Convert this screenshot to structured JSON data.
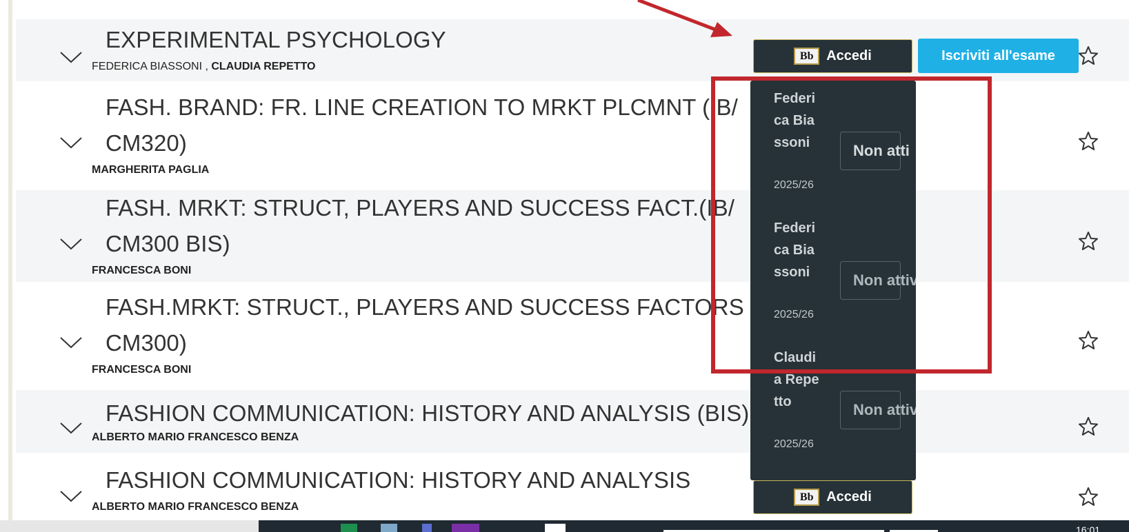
{
  "courses": [
    {
      "title_line1": "EXPERIMENTAL PSYCHOLOGY",
      "title_line2": "",
      "teacher_regular": "FEDERICA BIASSONI , ",
      "teacher_bold": "CLAUDIA REPETTO"
    },
    {
      "title_line1": "FASH. BRAND: FR. LINE CREATION TO MRKT PLCMNT (IB/",
      "title_line2": "CM320)",
      "teacher_regular": "",
      "teacher_bold": "MARGHERITA PAGLIA"
    },
    {
      "title_line1": "FASH. MRKT: STRUCT, PLAYERS AND SUCCESS FACT.(IB/",
      "title_line2": "CM300 BIS)",
      "teacher_regular": "",
      "teacher_bold": "FRANCESCA BONI"
    },
    {
      "title_line1": "FASH.MRKT: STRUCT., PLAYERS AND SUCCESS FACTORS (IB/",
      "title_line2": "CM300)",
      "teacher_regular": "",
      "teacher_bold": "FRANCESCA BONI"
    },
    {
      "title_line1": "FASHION COMMUNICATION: HISTORY AND ANALYSIS (BIS)",
      "title_line2": "",
      "teacher_regular": "",
      "teacher_bold": "ALBERTO MARIO FRANCESCO BENZA"
    },
    {
      "title_line1": "FASHION COMMUNICATION: HISTORY AND ANALYSIS",
      "title_line2": "",
      "teacher_regular": "",
      "teacher_bold": "ALBERTO MARIO FRANCESCO BENZA"
    }
  ],
  "buttons": {
    "accedi_label": "Accedi",
    "bb_logo_text": "Bb",
    "iscriviti_label": "Iscriviti all'esame"
  },
  "dropdown": {
    "items": [
      {
        "name": "Federica Biassoni",
        "date": "2025/26",
        "status": "Non atti"
      },
      {
        "name": "Federica Biassoni",
        "date": "2025/26",
        "status": "Non attivo"
      },
      {
        "name": "Claudia Repetto",
        "date": "2025/26",
        "status": "Non attivo"
      }
    ]
  },
  "taskbar": {
    "time": "16:01"
  },
  "colors": {
    "accedi_bg": "#263238",
    "iscriviti_bg": "#1fb0e6",
    "annotation_red": "#c1272d"
  }
}
